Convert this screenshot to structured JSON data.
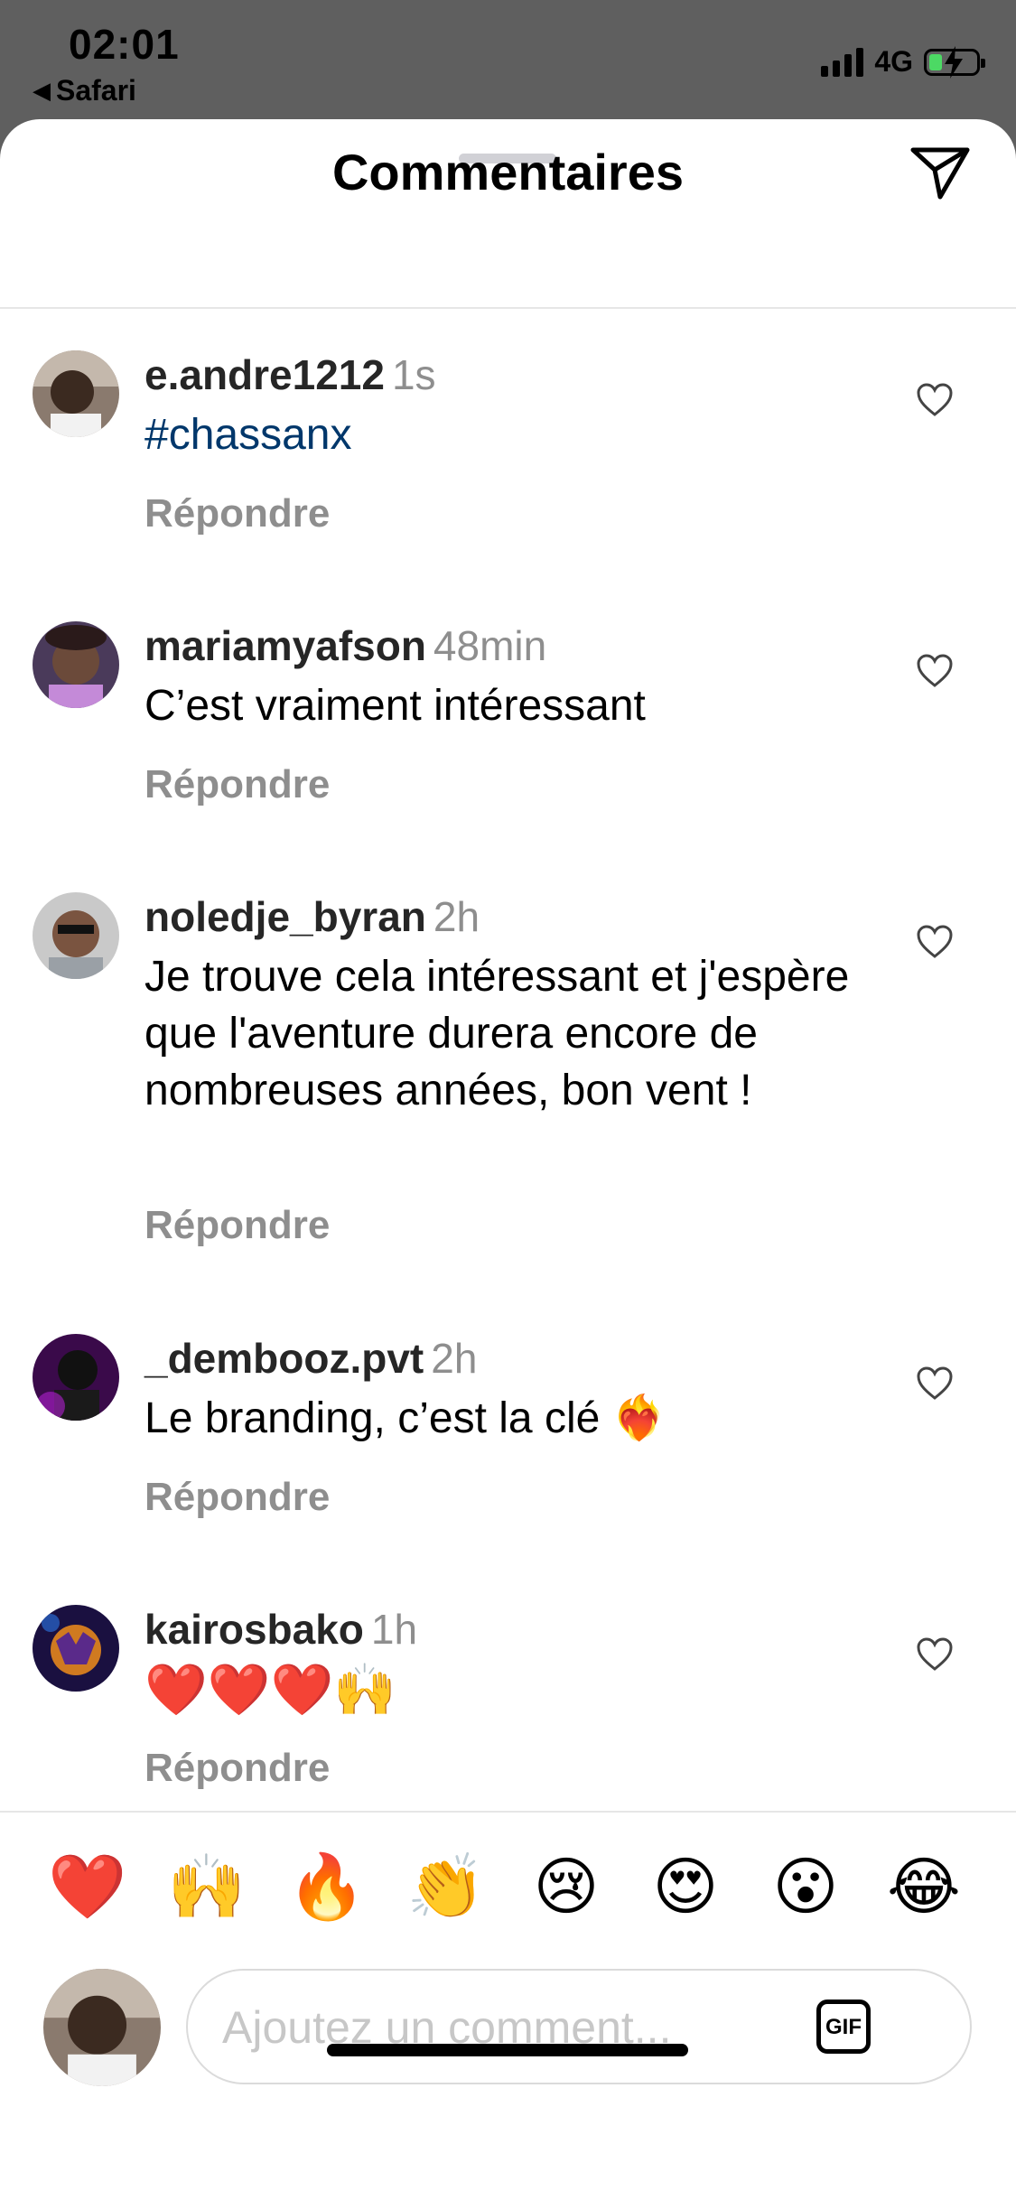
{
  "status": {
    "time": "02:01",
    "back_app": "Safari",
    "network": "4G"
  },
  "header": {
    "title": "Commentaires"
  },
  "comments": [
    {
      "username": "e.andre1212",
      "ago": "1s",
      "text": "#chassanx",
      "reply": "Répondre"
    },
    {
      "username": "mariamyafson",
      "ago": "48min",
      "text": "C’est vraiment intéressant",
      "reply": "Répondre"
    },
    {
      "username": "noledje_byran",
      "ago": "2h",
      "text": "Je trouve cela intéressant et j'espère que l'aventure durera encore de nombreuses années, bon vent !",
      "reply": "Répondre"
    },
    {
      "username": "_dembooz.pvt",
      "ago": "2h",
      "text": "Le branding, c’est la clé ❤️‍🔥",
      "reply": "Répondre"
    },
    {
      "username": "kairosbako",
      "ago": "1h",
      "text": "❤️❤️❤️🙌",
      "reply": "Répondre"
    }
  ],
  "quick_reactions": [
    "❤️",
    "🙌",
    "🔥",
    "👏",
    "😢",
    "😍",
    "😮",
    "😂"
  ],
  "composer": {
    "placeholder": "Ajoutez un comment...",
    "gif_label": "GIF"
  }
}
